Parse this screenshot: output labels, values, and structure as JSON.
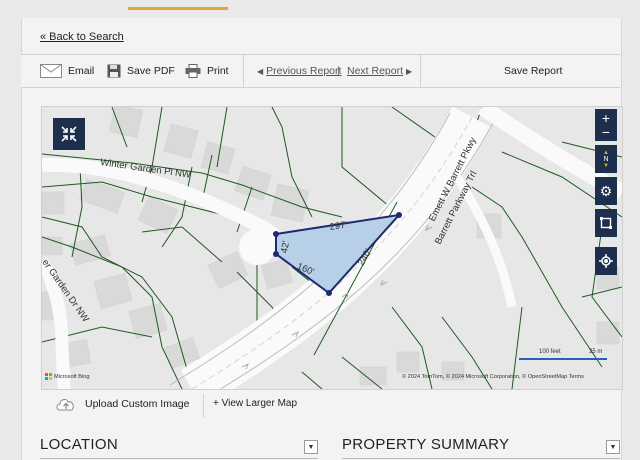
{
  "nav": {
    "back_label": "« Back to Search"
  },
  "toolbar": {
    "email_label": "Email",
    "save_pdf_label": "Save PDF",
    "print_label": "Print",
    "prev_label": "Previous Report",
    "divider": "|",
    "next_label": "Next Report",
    "save_report_label": "Save Report"
  },
  "map": {
    "streets": {
      "winter_garden_pl": "Winter Garden Pl NW",
      "winter_garden_dr": "er Garden Dr NW",
      "emmett": "Emett W Barrett Pkwy",
      "barrett_trl": "Barrett Parkway Trl"
    },
    "lot_dims": {
      "top": "297'",
      "left": "42'",
      "bottom": "160'",
      "right": "240'"
    },
    "controls": {
      "zoom_in": "+",
      "zoom_out": "−",
      "compass": "N"
    },
    "scale": {
      "feet": "100 feet",
      "meters": "25 m"
    },
    "attribution": "© 2024 TomTom, © 2024 Microsoft Corporation, © OpenStreetMap Terms",
    "logo_text": "Microsoft Bing",
    "upload_label": "Upload Custom Image",
    "larger_label": "+ View Larger Map"
  },
  "sections": {
    "location": "LOCATION",
    "summary": "PROPERTY SUMMARY"
  },
  "colors": {
    "accent": "#e2a72b",
    "control_bg": "#1d2f4d",
    "parcel_line": "#1e5a1e",
    "lot_fill": "#b8cfe8",
    "lot_stroke": "#1e2a6e"
  }
}
